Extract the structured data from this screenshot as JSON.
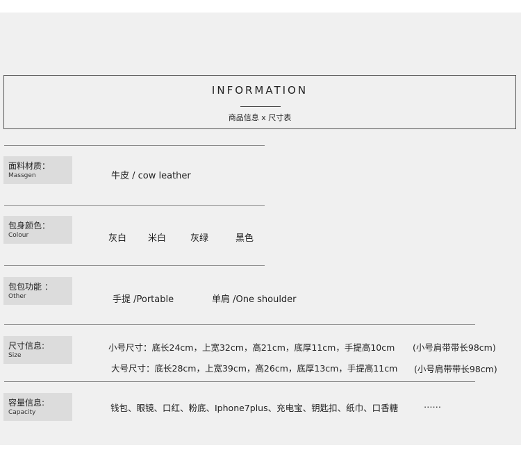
{
  "header": {
    "title": "INFORMATION",
    "subtitle": "商品信息 x 尺寸表"
  },
  "material": {
    "label_cn": "面料材质：",
    "label_en": "Massgen",
    "value": "牛皮 / cow leather"
  },
  "colour": {
    "label_cn": "包身颜色：",
    "label_en": "Colour",
    "options": [
      "灰白",
      "米白",
      "灰绿",
      "黑色"
    ]
  },
  "other": {
    "label_cn": "包包功能 ：",
    "label_en": "Other",
    "functions": [
      "手提 /Portable",
      "单肩 /One shoulder"
    ]
  },
  "size": {
    "label_cn": "尺寸信息:",
    "label_en": "Size",
    "small": "小号尺寸：底长24cm，上宽32cm，高21cm，底厚11cm，手提高10cm",
    "small_strap": "(小号肩带带长98cm)",
    "large": "大号尺寸：底长28cm，上宽39cm，高26cm，底厚13cm，手提高11cm",
    "large_strap": "(小号肩带带长98cm)"
  },
  "capacity": {
    "label_cn": "容量信息:",
    "label_en": "Capacity",
    "items": "钱包、眼镜、口红、粉底、Iphone7plus、充电宝、钥匙扣、纸巾、口香糖",
    "ellipsis": "……"
  }
}
